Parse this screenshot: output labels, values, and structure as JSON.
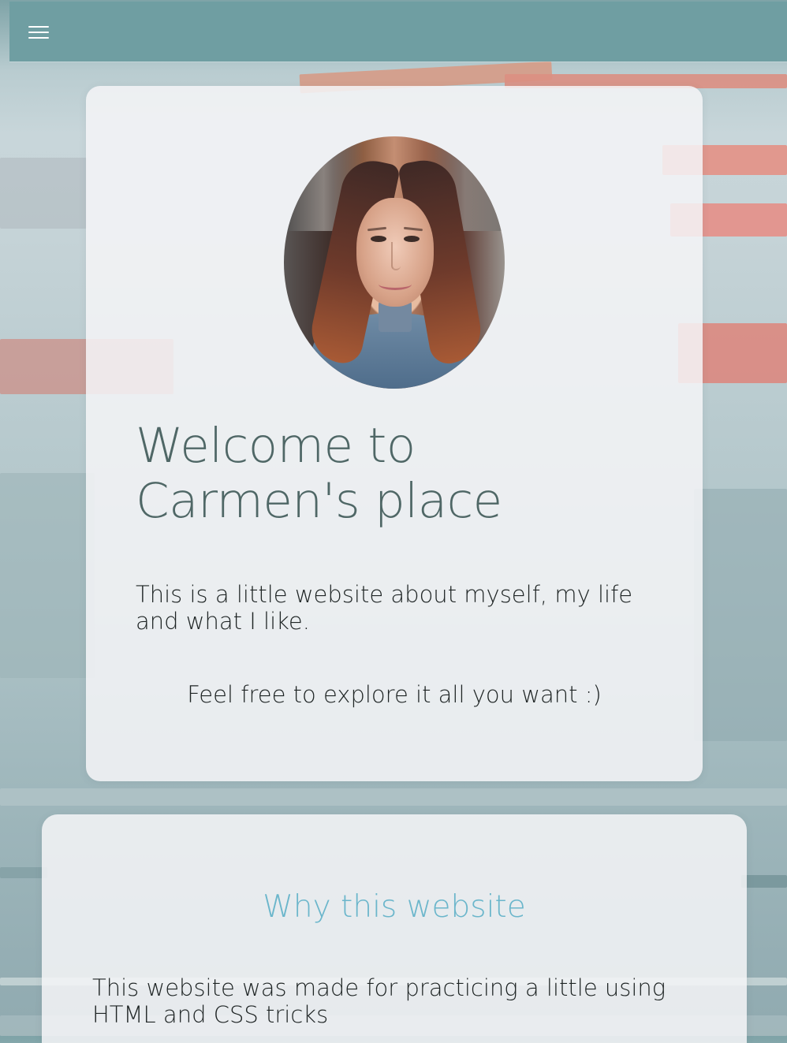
{
  "navigation": {
    "menu_icon": "hamburger-menu-icon"
  },
  "hero": {
    "title": "Welcome to Carmen's place",
    "intro": "This is a little website about myself, my life and what I like.",
    "call_to_action": "Feel free to explore it all you want :)"
  },
  "why_section": {
    "heading": "Why this website",
    "body": "This website was made for practicing a little using HTML and CSS tricks"
  },
  "colors": {
    "nav_bar": "#6f9ea2",
    "hero_title": "#4f6766",
    "section_heading": "#6bb6cb",
    "body_text": "#1e2424",
    "card_background": "#f5f5f7"
  }
}
